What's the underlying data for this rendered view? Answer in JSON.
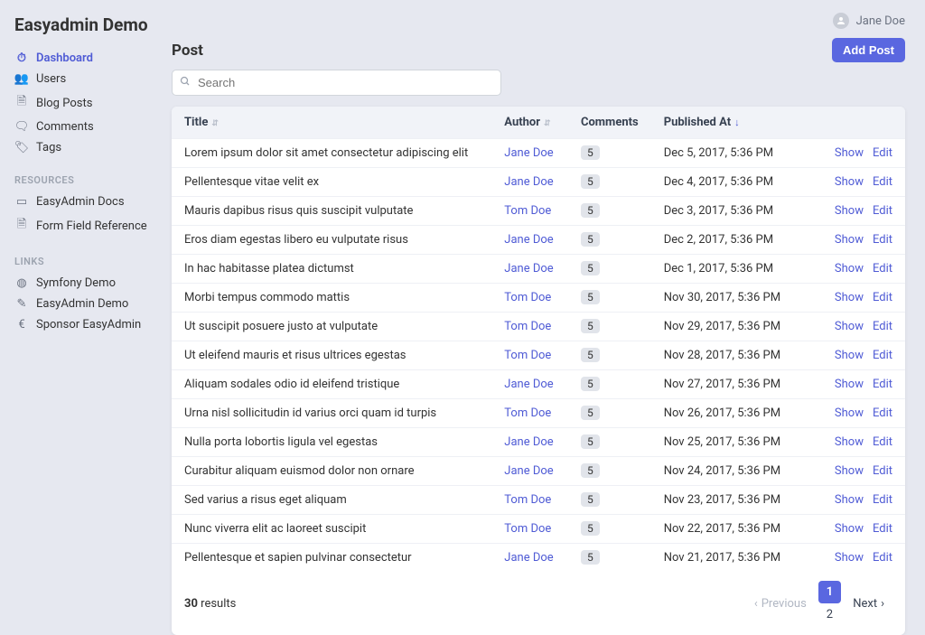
{
  "brand": "Easyadmin Demo",
  "user_name": "Jane Doe",
  "sidebar": {
    "nav": [
      {
        "label": "Dashboard",
        "icon": "speedometer",
        "active": true
      },
      {
        "label": "Users",
        "icon": "users"
      },
      {
        "label": "Blog Posts",
        "icon": "file"
      },
      {
        "label": "Comments",
        "icon": "comments"
      },
      {
        "label": "Tags",
        "icon": "tag"
      }
    ],
    "resources_heading": "RESOURCES",
    "resources": [
      {
        "label": "EasyAdmin Docs",
        "icon": "book"
      },
      {
        "label": "Form Field Reference",
        "icon": "file"
      }
    ],
    "links_heading": "LINKS",
    "links": [
      {
        "label": "Symfony Demo",
        "icon": "globe"
      },
      {
        "label": "EasyAdmin Demo",
        "icon": "wand"
      },
      {
        "label": "Sponsor EasyAdmin",
        "icon": "euro"
      }
    ]
  },
  "page_title": "Post",
  "add_button": "Add Post",
  "search_placeholder": "Search",
  "columns": {
    "title": "Title",
    "author": "Author",
    "comments": "Comments",
    "published": "Published At"
  },
  "rows": [
    {
      "title": "Lorem ipsum dolor sit amet consectetur adipiscing elit",
      "author": "Jane Doe",
      "comments": "5",
      "date": "Dec 5, 2017, 5:36 PM"
    },
    {
      "title": "Pellentesque vitae velit ex",
      "author": "Jane Doe",
      "comments": "5",
      "date": "Dec 4, 2017, 5:36 PM"
    },
    {
      "title": "Mauris dapibus risus quis suscipit vulputate",
      "author": "Tom Doe",
      "comments": "5",
      "date": "Dec 3, 2017, 5:36 PM"
    },
    {
      "title": "Eros diam egestas libero eu vulputate risus",
      "author": "Jane Doe",
      "comments": "5",
      "date": "Dec 2, 2017, 5:36 PM"
    },
    {
      "title": "In hac habitasse platea dictumst",
      "author": "Jane Doe",
      "comments": "5",
      "date": "Dec 1, 2017, 5:36 PM"
    },
    {
      "title": "Morbi tempus commodo mattis",
      "author": "Tom Doe",
      "comments": "5",
      "date": "Nov 30, 2017, 5:36 PM"
    },
    {
      "title": "Ut suscipit posuere justo at vulputate",
      "author": "Tom Doe",
      "comments": "5",
      "date": "Nov 29, 2017, 5:36 PM"
    },
    {
      "title": "Ut eleifend mauris et risus ultrices egestas",
      "author": "Tom Doe",
      "comments": "5",
      "date": "Nov 28, 2017, 5:36 PM"
    },
    {
      "title": "Aliquam sodales odio id eleifend tristique",
      "author": "Jane Doe",
      "comments": "5",
      "date": "Nov 27, 2017, 5:36 PM"
    },
    {
      "title": "Urna nisl sollicitudin id varius orci quam id turpis",
      "author": "Tom Doe",
      "comments": "5",
      "date": "Nov 26, 2017, 5:36 PM"
    },
    {
      "title": "Nulla porta lobortis ligula vel egestas",
      "author": "Jane Doe",
      "comments": "5",
      "date": "Nov 25, 2017, 5:36 PM"
    },
    {
      "title": "Curabitur aliquam euismod dolor non ornare",
      "author": "Jane Doe",
      "comments": "5",
      "date": "Nov 24, 2017, 5:36 PM"
    },
    {
      "title": "Sed varius a risus eget aliquam",
      "author": "Tom Doe",
      "comments": "5",
      "date": "Nov 23, 2017, 5:36 PM"
    },
    {
      "title": "Nunc viverra elit ac laoreet suscipit",
      "author": "Tom Doe",
      "comments": "5",
      "date": "Nov 22, 2017, 5:36 PM"
    },
    {
      "title": "Pellentesque et sapien pulvinar consectetur",
      "author": "Jane Doe",
      "comments": "5",
      "date": "Nov 21, 2017, 5:36 PM"
    }
  ],
  "action_show": "Show",
  "action_edit": "Edit",
  "results_count": "30",
  "results_label": "results",
  "pagination": {
    "previous": "Previous",
    "next": "Next",
    "pages": [
      "1",
      "2"
    ],
    "current": 0
  },
  "icons": {
    "speedometer": "⏱",
    "users": "👥",
    "file": "🗎",
    "comments": "🗨",
    "tag": "🏷",
    "book": "▭",
    "globe": "◍",
    "wand": "✎",
    "euro": "€"
  }
}
